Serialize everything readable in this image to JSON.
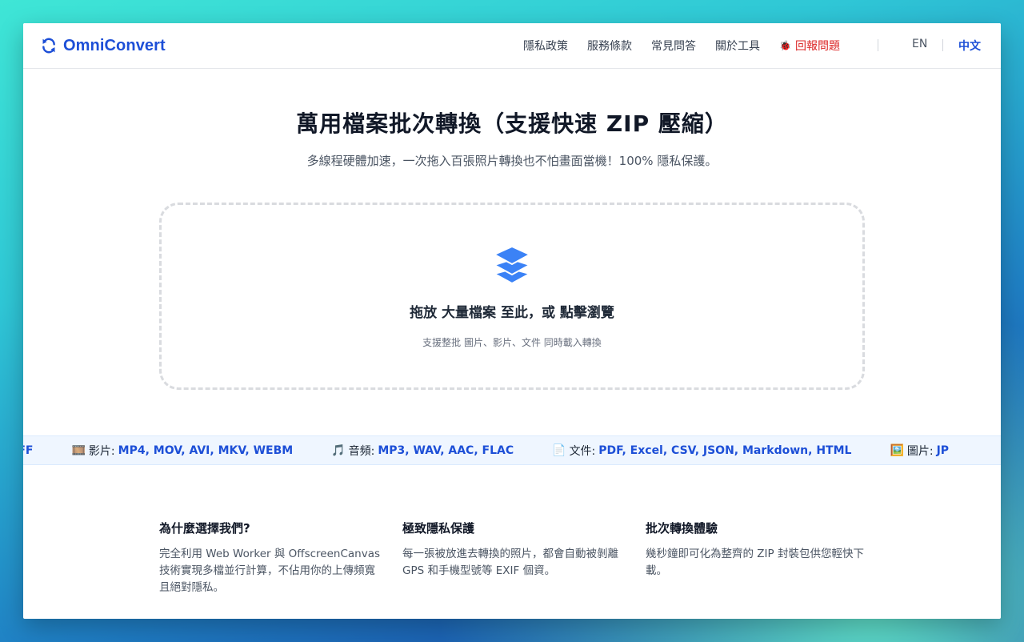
{
  "header": {
    "brand": "OmniConvert",
    "nav": [
      {
        "label": "隱私政策"
      },
      {
        "label": "服務條款"
      },
      {
        "label": "常見問答"
      },
      {
        "label": "關於工具"
      }
    ],
    "report_label": "回報問題",
    "lang_en": "EN",
    "lang_zh": "中文",
    "accent": "#1d4fd7",
    "report_color": "#dc2626"
  },
  "hero": {
    "title": "萬用檔案批次轉換（支援快速 ZIP 壓縮）",
    "subtitle": "多線程硬體加速，一次拖入百張照片轉換也不怕畫面當機！100% 隱私保護。"
  },
  "dropzone": {
    "icon": "layers-icon",
    "main": "拖放 大量檔案 至此，或 點擊瀏覽",
    "hint": "支援整批 圖片、影片、文件 同時載入轉換"
  },
  "ticker": {
    "lead": "F, SVG, BMP, TIFF",
    "items": [
      {
        "icon": "🎞️",
        "category": "影片:",
        "formats": "MP4, MOV, AVI, MKV, WEBM"
      },
      {
        "icon": "🎵",
        "category": "音頻:",
        "formats": "MP3, WAV, AAC, FLAC"
      },
      {
        "icon": "📄",
        "category": "文件:",
        "formats": "PDF, Excel, CSV, JSON, Markdown, HTML"
      },
      {
        "icon": "🖼️",
        "category": "圖片:",
        "formats": "JP"
      }
    ]
  },
  "features": [
    {
      "title": "為什麼選擇我們?",
      "body": "完全利用 Web Worker 與 OffscreenCanvas 技術實現多檔並行計算，不佔用你的上傳頻寬且絕對隱私。"
    },
    {
      "title": "極致隱私保護",
      "body": "每一張被放進去轉換的照片，都會自動被剝離 GPS 和手機型號等 EXIF 個資。"
    },
    {
      "title": "批次轉換體驗",
      "body": "幾秒鐘即可化為整齊的 ZIP 封裝包供您輕快下載。"
    }
  ]
}
